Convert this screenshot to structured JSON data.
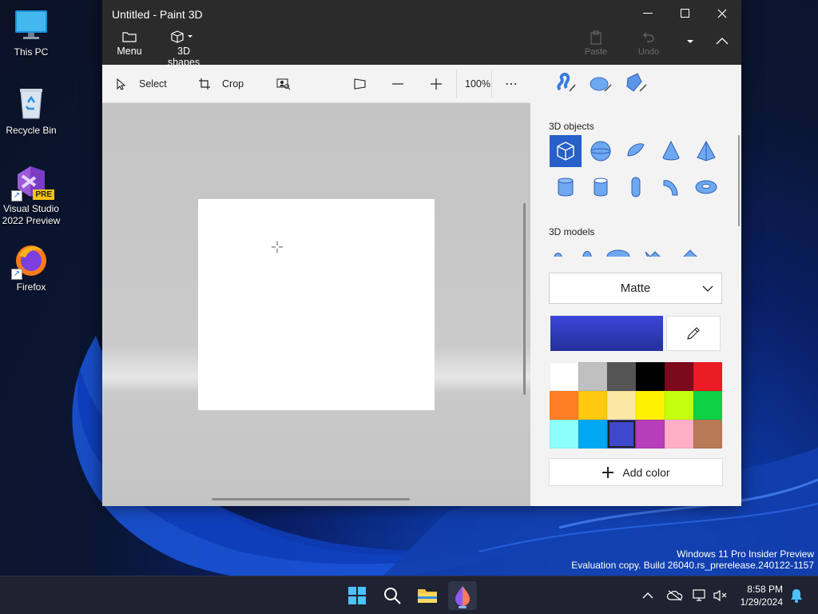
{
  "desktop": {
    "icons": [
      {
        "label": "This PC",
        "icon": "monitor-icon"
      },
      {
        "label": "Recycle Bin",
        "icon": "recycle-bin-icon"
      },
      {
        "label": "Visual Studio 2022 Preview",
        "icon": "visual-studio-icon",
        "badge": "PRE"
      },
      {
        "label": "Firefox",
        "icon": "firefox-icon"
      }
    ],
    "watermark": {
      "line1": "Windows 11 Pro Insider Preview",
      "line2": "Evaluation copy. Build 26040.rs_prerelease.240122-1157"
    }
  },
  "window": {
    "title": "Untitled - Paint 3D",
    "ribbon": {
      "menu_label": "Menu",
      "shapes_label": "3D shapes",
      "paste_label": "Paste",
      "undo_label": "Undo"
    },
    "toolbar": {
      "select_label": "Select",
      "crop_label": "Crop",
      "zoom_value": "100%",
      "more_label": "⋯"
    },
    "side_panel": {
      "objects_heading": "3D objects",
      "models_heading": "3D models",
      "material": "Matte",
      "current_color": "#3a46d8",
      "add_color_label": "Add color",
      "palette": [
        "#ffffff",
        "#c0c0c0",
        "#555555",
        "#000000",
        "#7c0a1c",
        "#ec1c24",
        "#ff7f27",
        "#ffc90e",
        "#fde8a3",
        "#fff200",
        "#c4ff0e",
        "#0ed145",
        "#8cfffb",
        "#00a8f3",
        "#3f48cc",
        "#b83dba",
        "#ffaec8",
        "#b97a57"
      ],
      "selected_swatch_index": 14
    }
  },
  "taskbar": {
    "time": "8:58 PM",
    "date": "1/29/2024"
  }
}
